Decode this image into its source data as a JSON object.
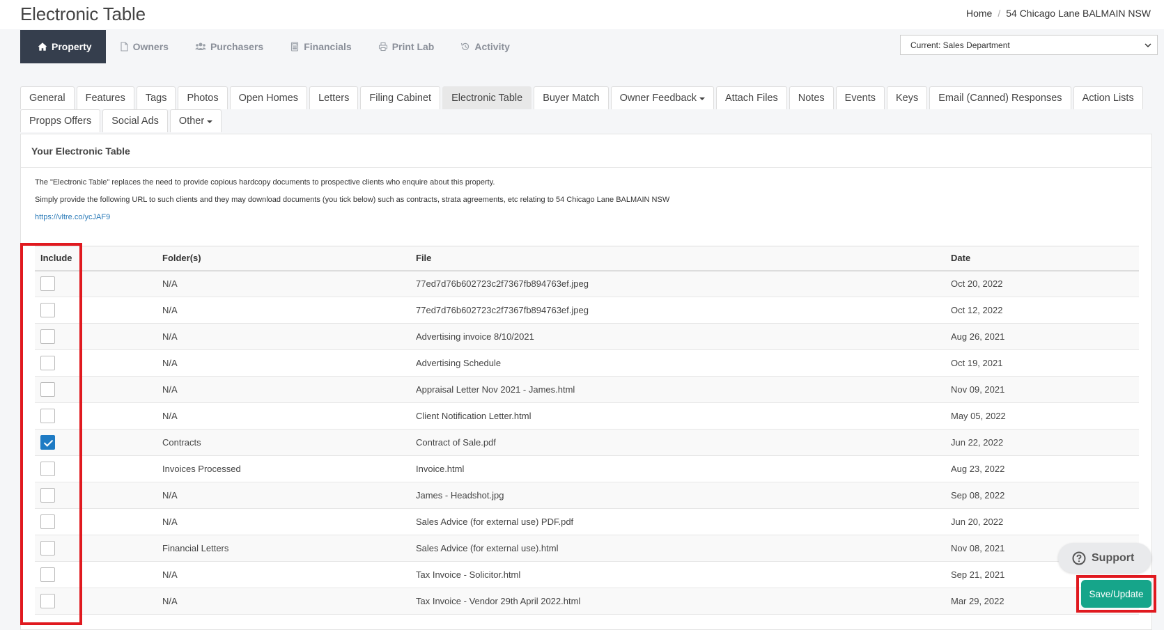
{
  "page_title": "Electronic Table",
  "breadcrumb": {
    "home": "Home",
    "current": "54 Chicago Lane BALMAIN NSW"
  },
  "main_nav": [
    {
      "label": "Property",
      "icon": "home-icon",
      "active": true
    },
    {
      "label": "Owners",
      "icon": "file-icon",
      "active": false
    },
    {
      "label": "Purchasers",
      "icon": "users-icon",
      "active": false
    },
    {
      "label": "Financials",
      "icon": "calculator-icon",
      "active": false
    },
    {
      "label": "Print Lab",
      "icon": "printer-icon",
      "active": false
    },
    {
      "label": "Activity",
      "icon": "history-icon",
      "active": false
    }
  ],
  "department_select": {
    "value": "Current: Sales Department"
  },
  "sub_tabs": {
    "row1": [
      "General",
      "Features",
      "Tags",
      "Photos",
      "Open Homes",
      "Letters",
      "Filing Cabinet",
      "Electronic Table",
      "Buyer Match",
      "Owner Feedback",
      "Attach Files",
      "Notes",
      "Events",
      "Keys",
      "Email (Canned) Responses",
      "Action Lists"
    ],
    "row2": [
      "Propps Offers",
      "Social Ads",
      "Other"
    ],
    "active": "Electronic Table"
  },
  "panel": {
    "heading": "Your Electronic Table",
    "desc1": "The \"Electronic Table\" replaces the need to provide copious hardcopy documents to prospective clients who enquire about this property.",
    "desc2": "Simply provide the following URL to such clients and they may download documents (you tick below) such as contracts, strata agreements, etc relating to 54 Chicago Lane BALMAIN NSW",
    "url": "https://vltre.co/ycJAF9"
  },
  "table": {
    "headers": {
      "include": "Include",
      "folder": "Folder(s)",
      "file": "File",
      "date": "Date"
    },
    "rows": [
      {
        "included": false,
        "folder": "N/A",
        "file": "77ed7d76b602723c2f7367fb894763ef.jpeg",
        "date": "Oct 20, 2022"
      },
      {
        "included": false,
        "folder": "N/A",
        "file": "77ed7d76b602723c2f7367fb894763ef.jpeg",
        "date": "Oct 12, 2022"
      },
      {
        "included": false,
        "folder": "N/A",
        "file": "Advertising invoice 8/10/2021",
        "date": "Aug 26, 2021"
      },
      {
        "included": false,
        "folder": "N/A",
        "file": "Advertising Schedule",
        "date": "Oct 19, 2021"
      },
      {
        "included": false,
        "folder": "N/A",
        "file": "Appraisal Letter Nov 2021 - James.html",
        "date": "Nov 09, 2021"
      },
      {
        "included": false,
        "folder": "N/A",
        "file": "Client Notification Letter.html",
        "date": "May 05, 2022"
      },
      {
        "included": true,
        "folder": "Contracts",
        "file": "Contract of Sale.pdf",
        "date": "Jun 22, 2022"
      },
      {
        "included": false,
        "folder": "Invoices Processed",
        "file": "Invoice.html",
        "date": "Aug 23, 2022"
      },
      {
        "included": false,
        "folder": "N/A",
        "file": "James - Headshot.jpg",
        "date": "Sep 08, 2022"
      },
      {
        "included": false,
        "folder": "N/A",
        "file": "Sales Advice (for external use) PDF.pdf",
        "date": "Jun 20, 2022"
      },
      {
        "included": false,
        "folder": "Financial Letters",
        "file": "Sales Advice (for external use).html",
        "date": "Nov 08, 2021"
      },
      {
        "included": false,
        "folder": "N/A",
        "file": "Tax Invoice - Solicitor.html",
        "date": "Sep 21, 2021"
      },
      {
        "included": false,
        "folder": "N/A",
        "file": "Tax Invoice - Vendor 29th April 2022.html",
        "date": "Mar 29, 2022"
      }
    ]
  },
  "support_label": "Support",
  "save_label": "Save/Update",
  "colors": {
    "nav_active": "#353e4d",
    "save": "#16a58a",
    "highlight": "#e0191f",
    "checkbox": "#1e7bc4"
  }
}
